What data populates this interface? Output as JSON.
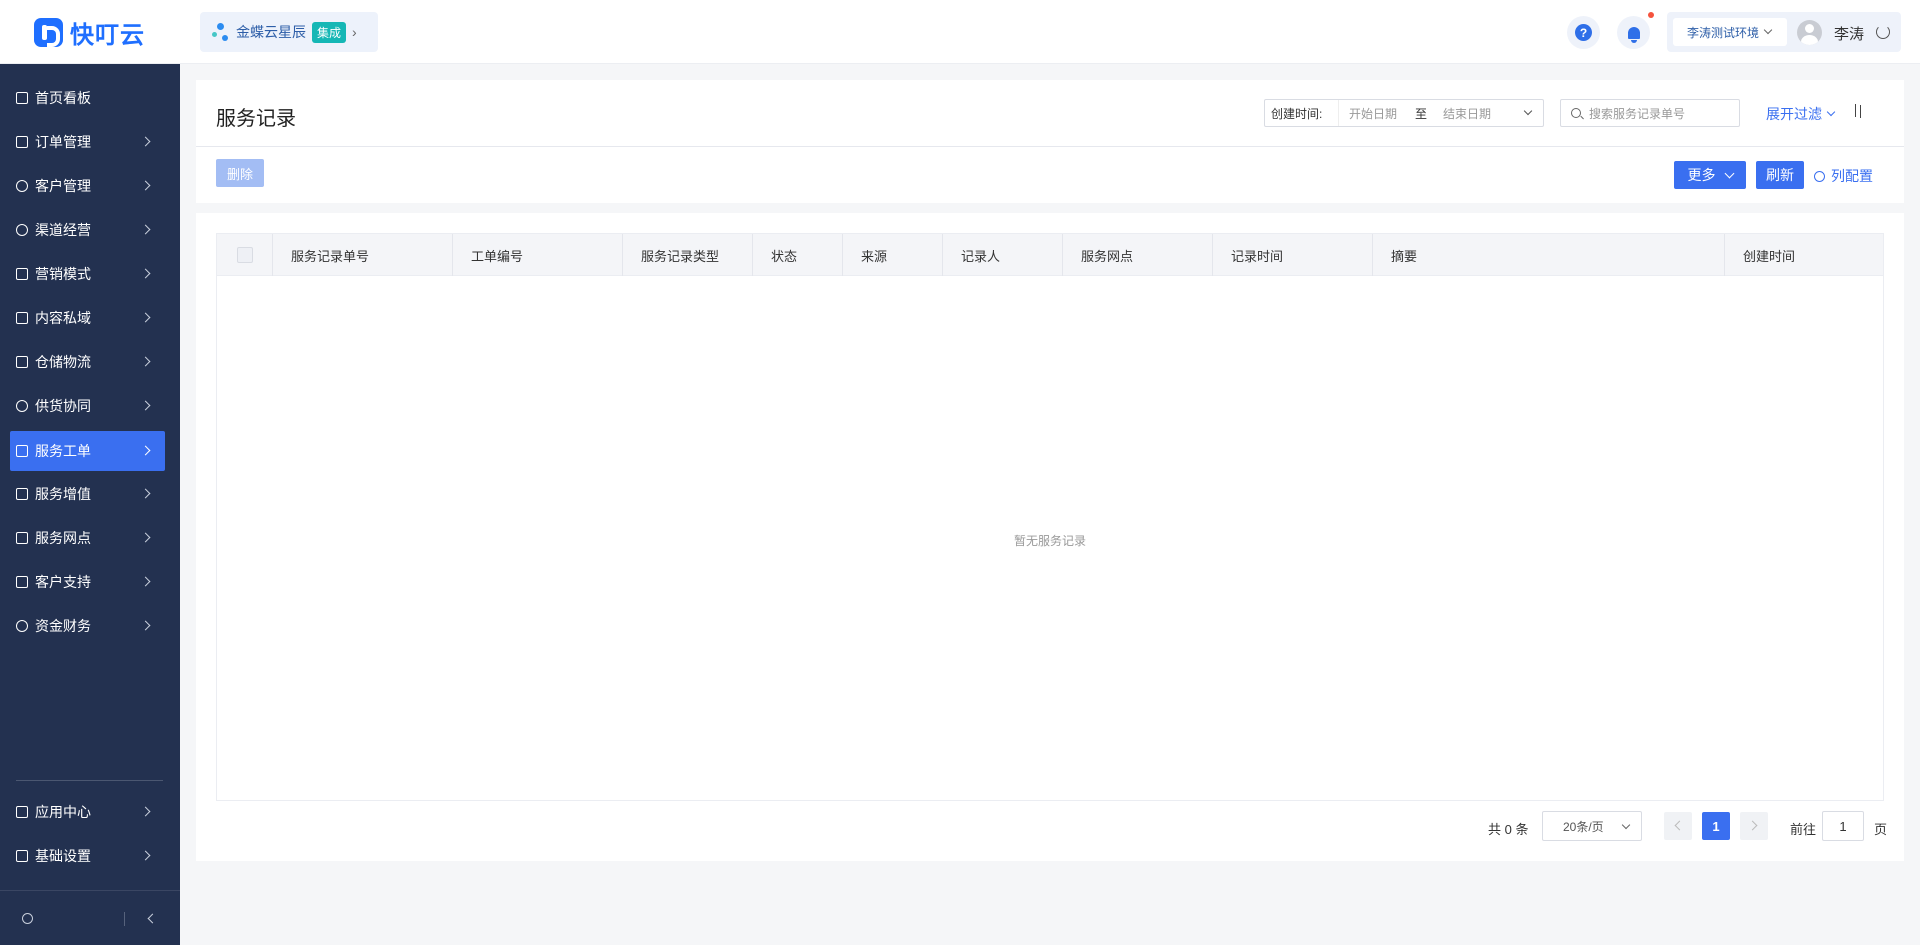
{
  "app": {
    "logo_text": "快叮云"
  },
  "tenant": {
    "name": "金蝶云星辰",
    "tag": "集成"
  },
  "header": {
    "help_glyph": "?",
    "environment": "李涛测试环境",
    "username": "李涛"
  },
  "sidebar": {
    "items": [
      {
        "label": "首页看板",
        "icon": "home-icon"
      },
      {
        "label": "订单管理",
        "icon": "order-icon"
      },
      {
        "label": "客户管理",
        "icon": "user-icon"
      },
      {
        "label": "渠道经营",
        "icon": "channel-icon"
      },
      {
        "label": "营销模式",
        "icon": "tag-icon"
      },
      {
        "label": "内容私域",
        "icon": "image-icon"
      },
      {
        "label": "仓储物流",
        "icon": "box-icon"
      },
      {
        "label": "供货协同",
        "icon": "supply-icon"
      },
      {
        "label": "服务工单",
        "icon": "ticket-icon"
      },
      {
        "label": "服务增值",
        "icon": "bag-icon"
      },
      {
        "label": "服务网点",
        "icon": "store-icon"
      },
      {
        "label": "客户支持",
        "icon": "support-icon"
      },
      {
        "label": "资金财务",
        "icon": "yuan-icon"
      }
    ],
    "bottom_items": [
      {
        "label": "应用中心",
        "icon": "cube-icon"
      },
      {
        "label": "基础设置",
        "icon": "settings-icon"
      }
    ],
    "active": "服务工单"
  },
  "page": {
    "title": "服务记录",
    "filter": {
      "date_label": "创建时间:",
      "start_placeholder": "开始日期",
      "separator": "至",
      "end_placeholder": "结束日期",
      "search_placeholder": "搜索服务记录单号",
      "expand_label": "展开过滤"
    },
    "toolbar": {
      "delete_label": "删除",
      "more_label": "更多",
      "refresh_label": "刷新",
      "column_config_label": "列配置"
    },
    "table": {
      "columns": [
        "服务记录单号",
        "工单编号",
        "服务记录类型",
        "状态",
        "来源",
        "记录人",
        "服务网点",
        "记录时间",
        "摘要",
        "创建时间"
      ],
      "empty_text": "暂无服务记录"
    },
    "pagination": {
      "total_label": "共 0 条",
      "page_size": "20条/页",
      "current_page": "1",
      "goto_label": "前往",
      "goto_value": "1",
      "goto_suffix": "页"
    }
  },
  "colors": {
    "brand": "#1f6fff",
    "sidebar_bg": "#233150",
    "active": "#3a6ff0",
    "tenant_tag": "#15b7b5"
  }
}
